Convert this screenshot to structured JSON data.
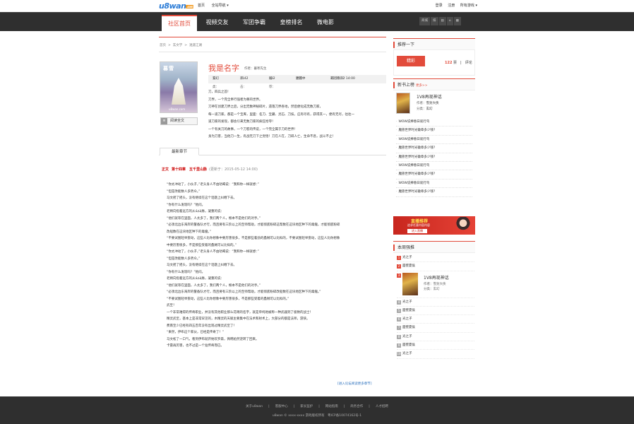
{
  "header": {
    "logo_text": "u8wan",
    "logo_suffix": ".com",
    "top_links": [
      "首页",
      "全站导航 ▾"
    ],
    "login": "登录",
    "register": "注册",
    "all_games": "所有游戏 ▾"
  },
  "nav": {
    "items": [
      "社区首页",
      "视频交友",
      "军团争霸",
      "皇榜排名",
      "微电影"
    ],
    "tools": [
      "商城",
      "排",
      "▤",
      "⌂",
      "▦"
    ]
  },
  "breadcrumb": [
    "首页",
    ">",
    "玄文学",
    ">",
    "逍遥江湖"
  ],
  "book": {
    "title": "我是名字",
    "author_label": "作者：",
    "author": "暮寒先生",
    "cover_title": "暮雪",
    "cover_brand": "u8wan.com",
    "read_label": "阅读全文",
    "read_icon": "≡",
    "info": {
      "cat_label": "分类：",
      "cat": "玄幻",
      "clicks_label": "点击：",
      "clicks": "1142",
      "recs_label": "推荐：",
      "recs": "132",
      "progress_label": "进程：",
      "progress": "更新中",
      "updated_label": "最后更新：",
      "updated": "15-05-12 14:00"
    },
    "desc": [
      "刀，四兵之首!",
      "刀界，一个完全奉行强者为尊的世界。",
      "刀神在创建刀界之后，分出无数神秘碎片，遗落刀界各地，然后便化成无数刀家，",
      "每一道刀家，都是一个宝库，里面：名刀、宝藏、灵石、刀技，应有尽有，获得其一，便有无尽，往往一",
      "道刀家的发现，都会引来无数刀家的疯狂抢夺！",
      "一个有关刀的故事，一个刀客的传说，一个完全属于刀的世界！",
      "身为刀客，当他刀一生，有战无刀下之觉悟！刀在人在，刀碎人亡，生命不息，战斗不止！"
    ]
  },
  "chapters": {
    "tab_label": "最新章节",
    "category": "正文",
    "latest": "第十四章　五千里山脉",
    "time": "(更新于：2015-05-12 14:00)",
    "content": [
      "“你太冲动了，小伙子，”老头身人不由劝喝说：“我和你一样就想：”",
      "“但是改能数人多势众。”",
      "马文摇了摇头，没有继续在这个话题上纠缠下去。",
      "“你有什么发现吗？”他问。",
      "老顾向指着远方的从山山脉，凝重的说：",
      "“他们就等在里面，人太多了，我们两个人，根本不是他们的对手。”",
      "“必须北边东海岸的警备队才行，而且要有三阶以上的至师帮助，才能彻底粉碎这帮数在这块地区种下的毒瘤，才能彻底粉碎",
      "改船数在这块地区种下的毒瘤。”",
      "“不要试图轻举妄动，这些人比你想象中要厉害很多，不是那些着劲的蟊贼可以比拟的，不要试图轻举妄动，这些人比你想象",
      "中要厉害很多，不是那些受着的蟊贼可以比拟的。”",
      "“你太冲动了，小伙子，”老头身人不由劝喝说：“我和你一样就想：”",
      "“但是改能数人多势众。”",
      "马文摇了摇头，没有继续在这个话题上纠缠下去。",
      "“你有什么发现吗？”他问。",
      "老顾向指着远方的从山山脉，凝重的说：",
      "“他们就等在里面，人太多了，我们两个人，根本不是他们的对手。”",
      "“必须北边东海岸的警备队才行，而且要有三阶以上的至师帮助，才能彻底粉碎改船数在这块地区种下的毒瘤。”",
      "“不要试图轻举妄动，这些人比你想象中要厉害很多，不是那些受着的蟊贼可以比拟的。”",
      "武至！",
      "一个非常难得的传奇职业，并没有其他职业那么花哨的名字，就是单纯地被称一种武器到了极致的战士！",
      "精灵武至，基本上是非常罕见的，木精灵的天赋主要集中在法术和射术上，大部分的都是法师，游侠。",
      "费南至少已经有四五百年没有出现过精灵武至了！",
      "“果然，伊布这个家伙，已经是传奇了！”",
      "马文松了一口气，看到伊布就开始欢罗森，佩韩尬然逆转了回来。",
      "卡雷再厉害，也不过是一个准传奇而已。"
    ],
    "more_label": "[进入论坛阅读更多章节]"
  },
  "sidebar": {
    "recommend": {
      "title": "推荐一下",
      "button": "精彩",
      "count": "122",
      "count_label": "票",
      "comment": "评论"
    },
    "newbooks": {
      "title": "新书上榜",
      "more": "更多>>",
      "featured_title": "1V8再现神话",
      "featured_author_label": "作者：",
      "featured_author": "雪封大侠",
      "featured_cat_label": "分类：",
      "featured_cat": "玄幻",
      "list": [
        "WOW说捧春日就行鸟",
        "魔兽世界时光徽章多少钱?",
        "WOW说捧春日就行鸟",
        "魔兽世界时光徽章多少钱?",
        "魔兽世界时光徽章多少钱?",
        "WOW说捧春日就行鸟",
        "魔兽世界时光徽章多少钱?",
        "WOW说捧春日就行鸟",
        "魔兽世界时光徽章多少钱?"
      ]
    },
    "ad": {
      "title": "直播推荐",
      "line": "追求任意内容内容",
      "button": "进入直播"
    },
    "weekly": {
      "title": "本周强推",
      "top": [
        "光之子",
        "面壁夏侯"
      ],
      "featured_num": "3",
      "featured_title": "1V8再现神话",
      "featured_author_label": "作者：",
      "featured_author": "雪封大侠",
      "featured_cat_label": "分类：",
      "featured_cat": "玄幻",
      "rest": [
        {
          "n": "4",
          "t": "光之子"
        },
        {
          "n": "5",
          "t": "面壁夏侯"
        },
        {
          "n": "6",
          "t": "光之子"
        },
        {
          "n": "7",
          "t": "面壁夏侯"
        },
        {
          "n": "8",
          "t": "光之子"
        },
        {
          "n": "9",
          "t": "面壁夏侯"
        },
        {
          "n": "10",
          "t": "光之子"
        }
      ]
    }
  },
  "footer": {
    "links": [
      "关于u8wan",
      "|",
      "客服中心",
      "|",
      "家长监护",
      "|",
      "网站指南",
      "|",
      "商务合作",
      "|",
      "人才招聘"
    ],
    "copy": "u8wan © xxxx-xxxx 游戏版权所有　粤ICP备10074162号-1"
  },
  "colors": {
    "accent": "#e24b3b",
    "nav_bg": "#2f2f2f",
    "link": "#2a6fbd"
  }
}
